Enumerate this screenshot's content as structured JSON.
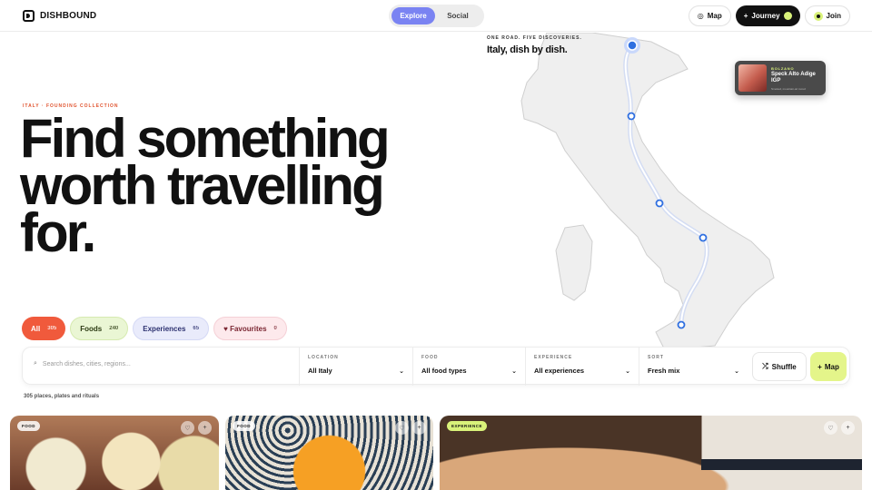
{
  "brand": {
    "name": "DISHBOUND"
  },
  "nav": {
    "tabs": [
      {
        "label": "Explore",
        "active": true
      },
      {
        "label": "Social",
        "active": false
      }
    ]
  },
  "header_actions": {
    "map_label": "Map",
    "journey_label": "Journey",
    "join_label": "Join"
  },
  "hero": {
    "eyebrow": "ITALY · FOUNDING COLLECTION",
    "headline": "Find something worth travelling for."
  },
  "map": {
    "kicker": "ONE ROAD. FIVE DISCOVERIES.",
    "title": "Italy, dish by dish.",
    "card": {
      "tag": "BOLZANO",
      "name": "Speck Alto Adige IGP",
      "sub": "Smoked, mountain-air cured"
    }
  },
  "chips": [
    {
      "label": "All",
      "count": "305"
    },
    {
      "label": "Foods",
      "count": "240"
    },
    {
      "label": "Experiences",
      "count": "65"
    },
    {
      "label": "♥ Favourites",
      "count": "0"
    }
  ],
  "search": {
    "placeholder": "Search dishes, cities, regions...",
    "filters": [
      {
        "label": "LOCATION",
        "value": "All Italy"
      },
      {
        "label": "FOOD",
        "value": "All food types"
      },
      {
        "label": "EXPERIENCE",
        "value": "All experiences"
      },
      {
        "label": "SORT",
        "value": "Fresh mix"
      }
    ],
    "shuffle_label": "Shuffle",
    "map_label": "Map"
  },
  "results_text": "305 places, plates and rituals",
  "cards": [
    {
      "badge": "FOOD"
    },
    {
      "badge": "FOOD"
    },
    {
      "badge": "EXPERIENCE"
    }
  ],
  "colors": {
    "accent": "#f05a3c",
    "lime": "#d9f27a",
    "explore": "#7a83f2",
    "route": "#2f6fe0"
  }
}
